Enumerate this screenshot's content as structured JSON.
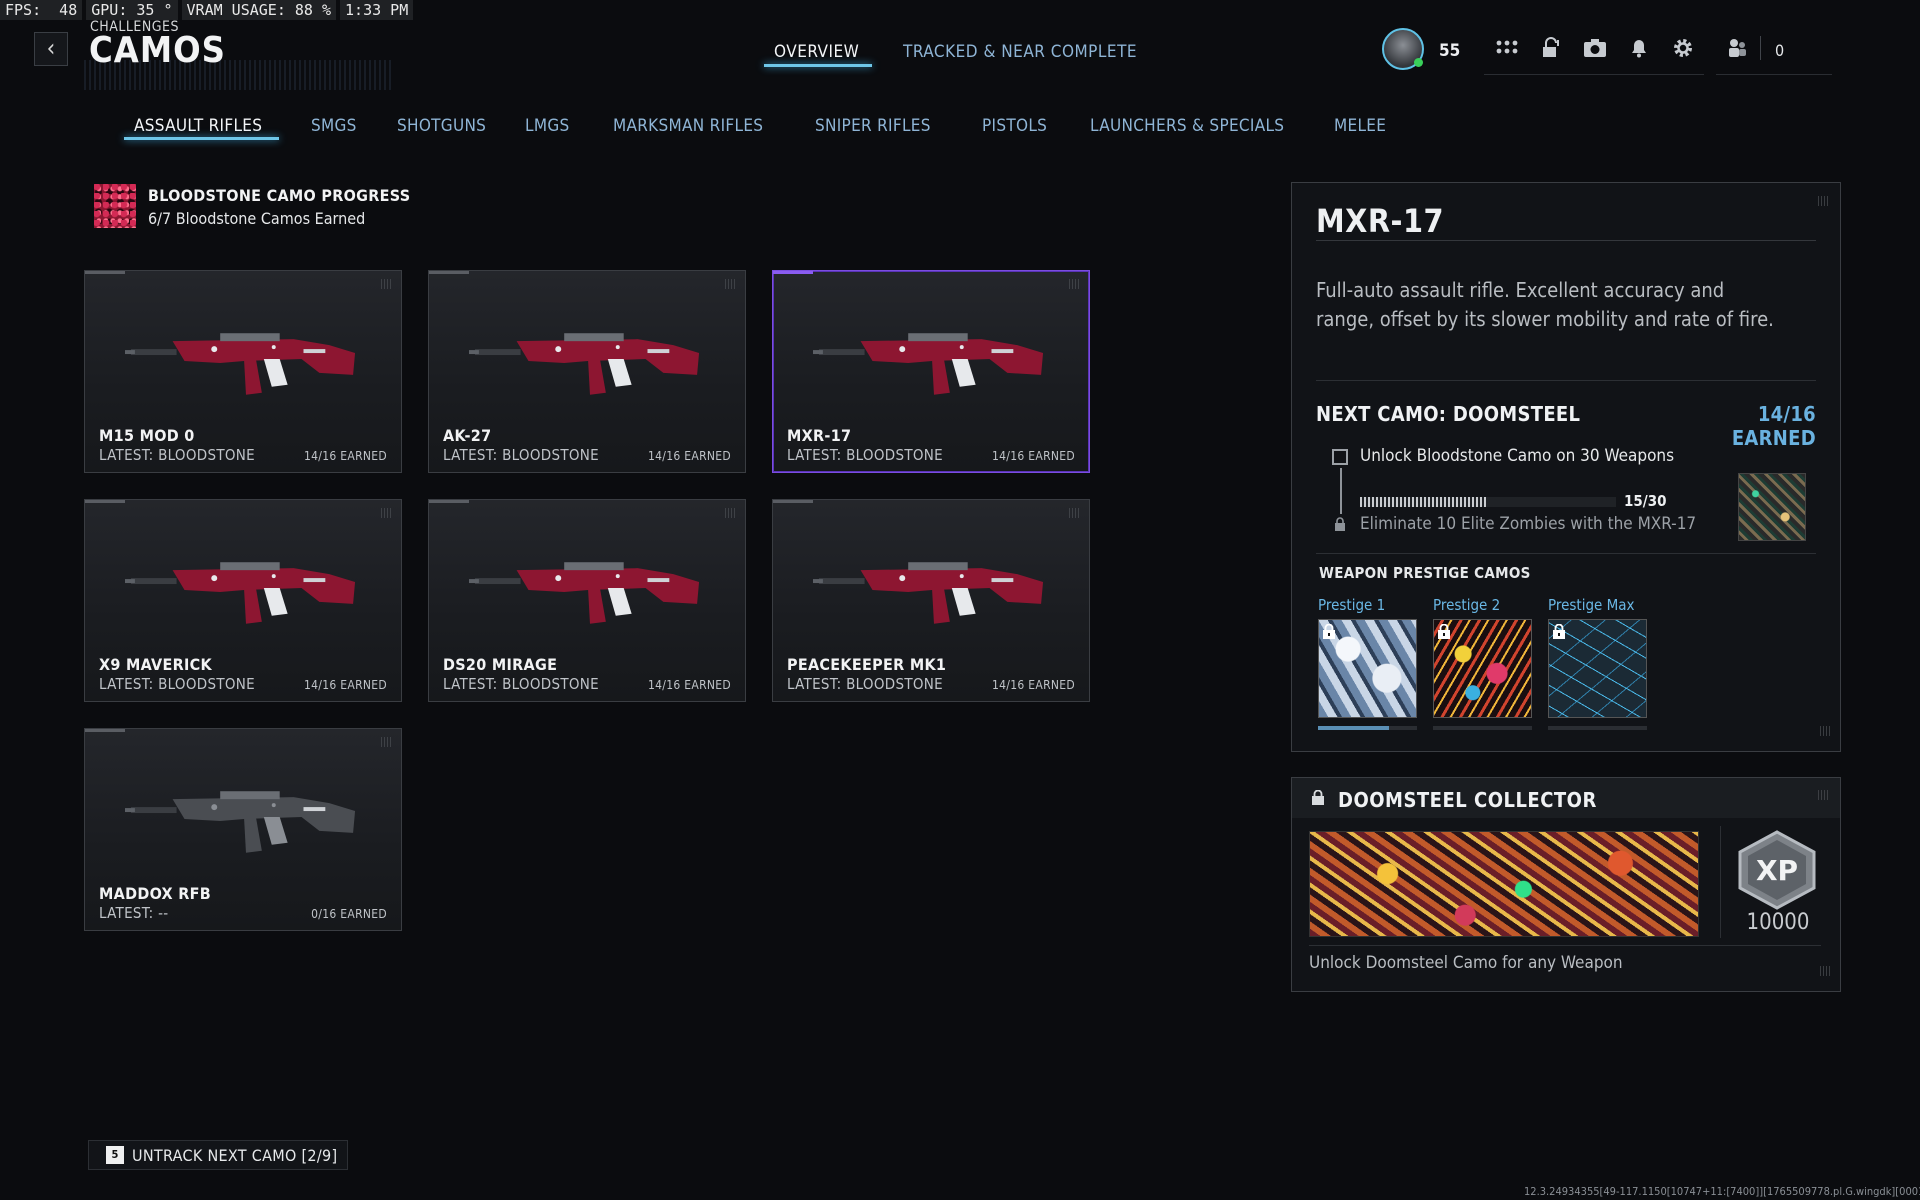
{
  "overlay": {
    "fps": "FPS:  48",
    "gpu": "GPU: 35 °",
    "vram": "VRAM USAGE: 88 %",
    "time": "1:33 PM"
  },
  "header": {
    "breadcrumb": "CHALLENGES",
    "title": "CAMOS",
    "back_icon": "‹",
    "tabs": [
      {
        "label": "OVERVIEW",
        "active": true
      },
      {
        "label": "TRACKED & NEAR COMPLETE",
        "active": false
      }
    ],
    "level": "55",
    "count": "0",
    "icons": [
      "grid-icon",
      "unlock-icon",
      "camera-icon",
      "bell-icon",
      "gear-icon",
      "friends-icon"
    ]
  },
  "weapon_tabs": [
    {
      "label": "ASSAULT RIFLES",
      "active": true
    },
    {
      "label": "SMGS"
    },
    {
      "label": "SHOTGUNS"
    },
    {
      "label": "LMGS"
    },
    {
      "label": "MARKSMAN RIFLES"
    },
    {
      "label": "SNIPER RIFLES"
    },
    {
      "label": "PISTOLS"
    },
    {
      "label": "LAUNCHERS & SPECIALS"
    },
    {
      "label": "MELEE"
    }
  ],
  "progress": {
    "title": "BLOODSTONE CAMO PROGRESS",
    "subtitle": "6/7 Bloodstone Camos Earned"
  },
  "weapons": [
    {
      "name": "M15 MOD 0",
      "latest": "LATEST: BLOODSTONE",
      "earned": "14/16 EARNED",
      "camo": "bloodstone"
    },
    {
      "name": "AK-27",
      "latest": "LATEST: BLOODSTONE",
      "earned": "14/16 EARNED",
      "camo": "bloodstone"
    },
    {
      "name": "MXR-17",
      "latest": "LATEST: BLOODSTONE",
      "earned": "14/16 EARNED",
      "camo": "bloodstone",
      "selected": true
    },
    {
      "name": "X9 MAVERICK",
      "latest": "LATEST: BLOODSTONE",
      "earned": "14/16 EARNED",
      "camo": "bloodstone"
    },
    {
      "name": "DS20 MIRAGE",
      "latest": "LATEST: BLOODSTONE",
      "earned": "14/16 EARNED",
      "camo": "bloodstone"
    },
    {
      "name": "PEACEKEEPER MK1",
      "latest": "LATEST: BLOODSTONE",
      "earned": "14/16 EARNED",
      "camo": "bloodstone"
    },
    {
      "name": "MADDOX RFB",
      "latest": "LATEST: --",
      "earned": "0/16 EARNED",
      "camo": "none"
    }
  ],
  "detail": {
    "title": "MXR-17",
    "description": "Full-auto assault rifle. Excellent accuracy and range, offset by its slower mobility and rate of fire.",
    "next_camo_label": "NEXT CAMO: DOOMSTEEL",
    "next_camo_earned": "14/16 EARNED",
    "task1": "Unlock Bloodstone Camo on 30 Weapons",
    "task1_progress": "15/30",
    "task1_fraction": 0.5,
    "task2": "Eliminate 10 Elite Zombies with the MXR-17",
    "prestige_title": "WEAPON PRESTIGE CAMOS",
    "prestige": [
      {
        "label": "Prestige 1",
        "progress": 0.72
      },
      {
        "label": "Prestige 2",
        "progress": 0
      },
      {
        "label": "Prestige Max",
        "progress": 0
      }
    ]
  },
  "collector": {
    "title": "DOOMSTEEL COLLECTOR",
    "xp_badge": "XP",
    "xp": "10000",
    "description": "Unlock Doomsteel Camo for any Weapon"
  },
  "footer": {
    "key": "5",
    "untrack": "UNTRACK NEXT CAMO [2/9]",
    "build": "12.3.24934355[49-117.1150[10747+11:[7400]][1765509778.pl.G.wingdk][0001221ff00]"
  },
  "colors": {
    "accent": "#6ec6e8",
    "selected": "#8a5cf0",
    "bloodstone": "#8d1631",
    "link": "#8fb5d6"
  }
}
